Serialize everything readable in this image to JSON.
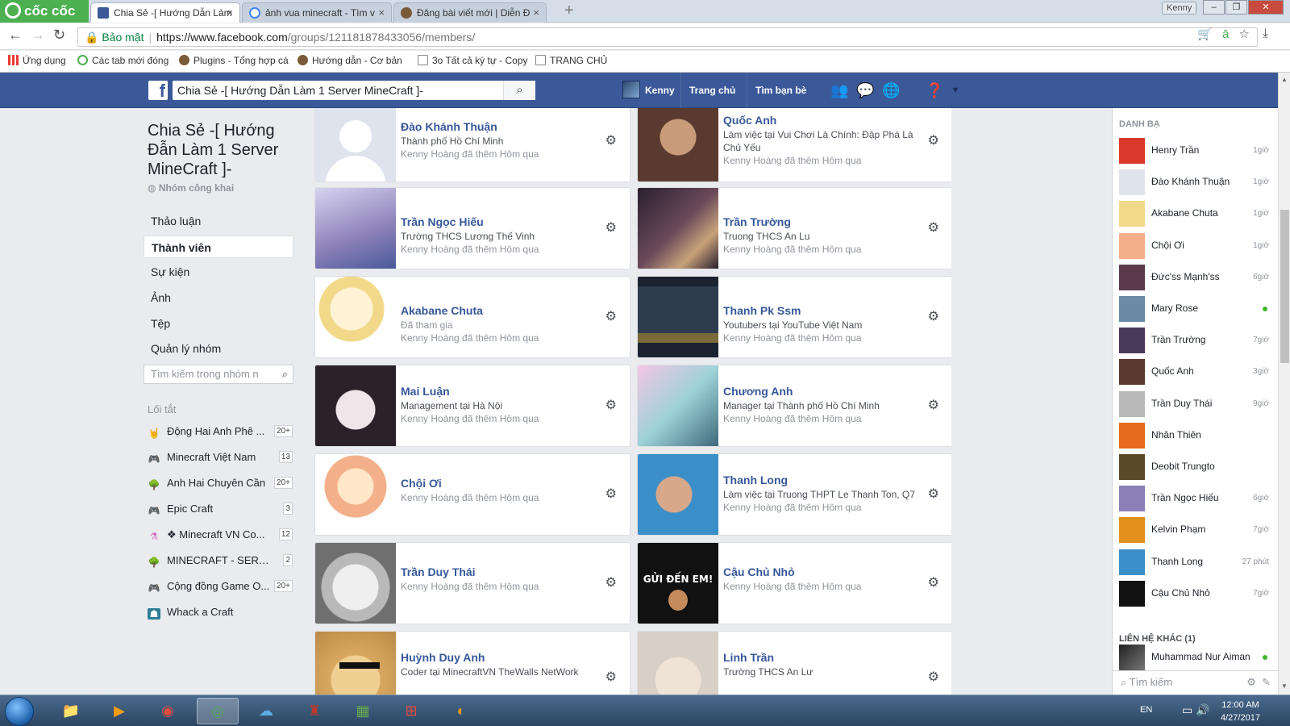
{
  "browser": {
    "brand": "cốc cốc",
    "tabs": [
      {
        "label": "Chia Sẻ -[ Hướng Dẫn Làm",
        "active": true,
        "icon": "facebook-icon"
      },
      {
        "label": "ảnh vua minecraft - Tìm v",
        "active": false,
        "icon": "google-icon"
      },
      {
        "label": "Đăng bài viết mới | Diễn Đ",
        "active": false,
        "icon": "forum-icon"
      }
    ],
    "user_button": "Kenny",
    "secure_label": "Bảo mật",
    "url_host": "https://www.facebook.com",
    "url_rest": "/groups/121181878433056/members/",
    "bookmarks": [
      {
        "label": "Ứng dụng",
        "color": "#e53935"
      },
      {
        "label": "Các tab mới đóng",
        "color": "#4caf50"
      },
      {
        "label": "Plugins - Tổng hợp cá",
        "color": "#7b5a3a"
      },
      {
        "label": "Hướng dẫn - Cơ bản",
        "color": "#7b5a3a"
      },
      {
        "label": "3o Tất cả ký tự - Copy",
        "color": "#888888"
      },
      {
        "label": "TRANG CHỦ",
        "color": "#888888"
      }
    ]
  },
  "fb": {
    "search_value": "Chia Sẻ -[ Hướng Dẫn Làm 1 Server MineCraft ]-",
    "user_name": "Kenny",
    "nav_home": "Trang chủ",
    "nav_find_friends": "Tìm bạn bè",
    "accent": "#3b5998"
  },
  "group": {
    "title": "Chia Sẻ -[ Hướng Đẫn Làm 1 Server MineCraft ]-",
    "privacy": "Nhóm công khai",
    "nav": [
      "Thảo luận",
      "Thành viên",
      "Sự kiện",
      "Ảnh",
      "Tệp",
      "Quản lý nhóm"
    ],
    "active_nav": "Thành viên",
    "search_placeholder": "Tìm kiếm trong nhóm n",
    "shortcuts_heading": "Lối tắt",
    "shortcuts": [
      {
        "name": "Động Hai Anh Phê ...",
        "count": "20+",
        "icon": "rock-hand-icon"
      },
      {
        "name": "Minecraft Việt Nam",
        "count": "13",
        "icon": "gamepad-icon"
      },
      {
        "name": "Anh Hai Chuyên Cần",
        "count": "20+",
        "icon": "tree-icon"
      },
      {
        "name": "Epic Craft",
        "count": "3",
        "icon": "gamepad-icon"
      },
      {
        "name": "❖ Minecraft VN Co...",
        "count": "12",
        "icon": "flask-icon"
      },
      {
        "name": "MINECRAFT - SERV...",
        "count": "2",
        "icon": "tree-icon"
      },
      {
        "name": "Cộng đồng Game O...",
        "count": "20+",
        "icon": "gamepad-icon"
      },
      {
        "name": "Whack a Craft",
        "count": "",
        "icon": "game-character-icon"
      }
    ]
  },
  "members": [
    {
      "name": "Đào Khánh Thuận",
      "lines": [
        "Thành phố Hồ Chí Minh",
        "Kenny Hoàng đã thêm Hôm qua"
      ],
      "color": "#dfe3ee"
    },
    {
      "name": "Quốc Anh",
      "lines": [
        "Làm việc tại Vui Chơi Là Chính: Đập Phá Là Chủ Yếu",
        "Kenny Hoàng đã thêm Hôm qua"
      ],
      "color": "#5a3a2e"
    },
    {
      "name": "Trần Ngọc Hiếu",
      "lines": [
        "Trường THCS Lương Thế Vinh",
        "Kenny Hoàng đã thêm Hôm qua"
      ],
      "color": "#8a7fb8"
    },
    {
      "name": "Trần Trường",
      "lines": [
        "Truong THCS An Lu",
        "Kenny Hoàng đã thêm Hôm qua"
      ],
      "color": "#4a3a5a"
    },
    {
      "name": "Akabane Chuta",
      "lines": [
        "Đã tham gia",
        "Kenny Hoàng đã thêm Hôm qua"
      ],
      "color": "#f2d98a"
    },
    {
      "name": "Thanh Pk Ssm",
      "lines": [
        "Youtubers tại YouTube Việt Nam",
        "Kenny Hoàng đã thêm Hôm qua"
      ],
      "color": "#2a3442"
    },
    {
      "name": "Mai Luận",
      "lines": [
        "Management tại Hà Nội",
        "Kenny Hoàng đã thêm Hôm qua"
      ],
      "color": "#6b5c70"
    },
    {
      "name": "Chương Anh",
      "lines": [
        "Manager tại Thành phố Hồ Chí Minh",
        "Kenny Hoàng đã thêm Hôm qua"
      ],
      "color": "#9ed2d8"
    },
    {
      "name": "Chội Ơi",
      "lines": [
        "Kenny Hoàng đã thêm Hôm qua"
      ],
      "color": "#f4b08a"
    },
    {
      "name": "Thanh Long",
      "lines": [
        "Làm việc tại Truong THPT Le Thanh Ton, Q7",
        "Kenny Hoàng đã thêm Hôm qua"
      ],
      "color": "#3a8fc9"
    },
    {
      "name": "Trần Duy Thái",
      "lines": [
        "Kenny Hoàng đã thêm Hôm qua"
      ],
      "color": "#b9b9b9"
    },
    {
      "name": "Cậu Chủ Nhỏ",
      "lines": [
        "Kenny Hoàng đã thêm Hôm qua"
      ],
      "color": "#111111",
      "photo_text": "GỬI ĐẾN EM!"
    },
    {
      "name": "Huỳnh Duy Anh",
      "lines": [
        "Coder tại MinecraftVN TheWalls NetWork"
      ],
      "color": "#d9a860"
    },
    {
      "name": "Linh Trần",
      "lines": [
        "Trường THCS An Lư"
      ],
      "color": "#d8cfc6"
    }
  ],
  "chat": {
    "heading": "DANH BẠ",
    "contacts": [
      {
        "name": "Henry Trần",
        "time": "1giờ",
        "color": "#d9382b"
      },
      {
        "name": "Đào Khánh Thuận",
        "time": "1giờ",
        "color": "#dfe3ee"
      },
      {
        "name": "Akabane Chuta",
        "time": "1giờ",
        "color": "#f2d98a"
      },
      {
        "name": "Chội Ơi",
        "time": "1giờ",
        "color": "#f4b08a"
      },
      {
        "name": "Đức'ss Mạnh'ss",
        "time": "6giờ",
        "color": "#5a3a4a"
      },
      {
        "name": "Mary Rose",
        "time": "",
        "online": true,
        "color": "#6a8aa8"
      },
      {
        "name": "Trần Trường",
        "time": "7giờ",
        "color": "#4a3a5a"
      },
      {
        "name": "Quốc Anh",
        "time": "3giờ",
        "color": "#5a3a2e"
      },
      {
        "name": "Trần Duy Thái",
        "time": "9giờ",
        "color": "#b9b9b9"
      },
      {
        "name": "Nhân Thiên",
        "time": "",
        "color": "#e86a1c"
      },
      {
        "name": "Deobit Trungto",
        "time": "",
        "color": "#5a4a2a"
      },
      {
        "name": "Trần Ngọc Hiếu",
        "time": "6giờ",
        "color": "#8a7fb8"
      },
      {
        "name": "Kelvin Phạm",
        "time": "7giờ",
        "color": "#e0901c"
      },
      {
        "name": "Thanh Long",
        "time": "27 phút",
        "color": "#3a8fc9"
      },
      {
        "name": "Cậu Chủ Nhỏ",
        "time": "7giờ",
        "color": "#111111"
      }
    ],
    "other_heading": "LIÊN HỆ KHÁC (1)",
    "other_contacts": [
      {
        "name": "Muhammad Nur Aiman",
        "online": true,
        "color": "#444444"
      }
    ],
    "search_placeholder": "Tìm kiếm"
  },
  "taskbar": {
    "lang": "EN",
    "time": "12:00 AM",
    "date": "4/27/2017"
  }
}
